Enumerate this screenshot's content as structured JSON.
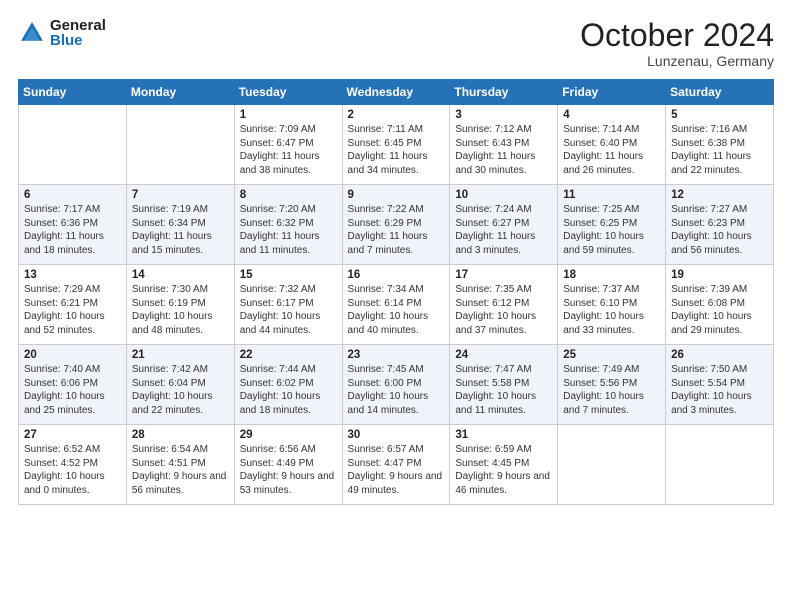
{
  "header": {
    "logo_general": "General",
    "logo_blue": "Blue",
    "title": "October 2024",
    "subtitle": "Lunzenau, Germany"
  },
  "weekdays": [
    "Sunday",
    "Monday",
    "Tuesday",
    "Wednesday",
    "Thursday",
    "Friday",
    "Saturday"
  ],
  "weeks": [
    [
      {
        "day": "",
        "info": ""
      },
      {
        "day": "",
        "info": ""
      },
      {
        "day": "1",
        "info": "Sunrise: 7:09 AM\nSunset: 6:47 PM\nDaylight: 11 hours and 38 minutes."
      },
      {
        "day": "2",
        "info": "Sunrise: 7:11 AM\nSunset: 6:45 PM\nDaylight: 11 hours and 34 minutes."
      },
      {
        "day": "3",
        "info": "Sunrise: 7:12 AM\nSunset: 6:43 PM\nDaylight: 11 hours and 30 minutes."
      },
      {
        "day": "4",
        "info": "Sunrise: 7:14 AM\nSunset: 6:40 PM\nDaylight: 11 hours and 26 minutes."
      },
      {
        "day": "5",
        "info": "Sunrise: 7:16 AM\nSunset: 6:38 PM\nDaylight: 11 hours and 22 minutes."
      }
    ],
    [
      {
        "day": "6",
        "info": "Sunrise: 7:17 AM\nSunset: 6:36 PM\nDaylight: 11 hours and 18 minutes."
      },
      {
        "day": "7",
        "info": "Sunrise: 7:19 AM\nSunset: 6:34 PM\nDaylight: 11 hours and 15 minutes."
      },
      {
        "day": "8",
        "info": "Sunrise: 7:20 AM\nSunset: 6:32 PM\nDaylight: 11 hours and 11 minutes."
      },
      {
        "day": "9",
        "info": "Sunrise: 7:22 AM\nSunset: 6:29 PM\nDaylight: 11 hours and 7 minutes."
      },
      {
        "day": "10",
        "info": "Sunrise: 7:24 AM\nSunset: 6:27 PM\nDaylight: 11 hours and 3 minutes."
      },
      {
        "day": "11",
        "info": "Sunrise: 7:25 AM\nSunset: 6:25 PM\nDaylight: 10 hours and 59 minutes."
      },
      {
        "day": "12",
        "info": "Sunrise: 7:27 AM\nSunset: 6:23 PM\nDaylight: 10 hours and 56 minutes."
      }
    ],
    [
      {
        "day": "13",
        "info": "Sunrise: 7:29 AM\nSunset: 6:21 PM\nDaylight: 10 hours and 52 minutes."
      },
      {
        "day": "14",
        "info": "Sunrise: 7:30 AM\nSunset: 6:19 PM\nDaylight: 10 hours and 48 minutes."
      },
      {
        "day": "15",
        "info": "Sunrise: 7:32 AM\nSunset: 6:17 PM\nDaylight: 10 hours and 44 minutes."
      },
      {
        "day": "16",
        "info": "Sunrise: 7:34 AM\nSunset: 6:14 PM\nDaylight: 10 hours and 40 minutes."
      },
      {
        "day": "17",
        "info": "Sunrise: 7:35 AM\nSunset: 6:12 PM\nDaylight: 10 hours and 37 minutes."
      },
      {
        "day": "18",
        "info": "Sunrise: 7:37 AM\nSunset: 6:10 PM\nDaylight: 10 hours and 33 minutes."
      },
      {
        "day": "19",
        "info": "Sunrise: 7:39 AM\nSunset: 6:08 PM\nDaylight: 10 hours and 29 minutes."
      }
    ],
    [
      {
        "day": "20",
        "info": "Sunrise: 7:40 AM\nSunset: 6:06 PM\nDaylight: 10 hours and 25 minutes."
      },
      {
        "day": "21",
        "info": "Sunrise: 7:42 AM\nSunset: 6:04 PM\nDaylight: 10 hours and 22 minutes."
      },
      {
        "day": "22",
        "info": "Sunrise: 7:44 AM\nSunset: 6:02 PM\nDaylight: 10 hours and 18 minutes."
      },
      {
        "day": "23",
        "info": "Sunrise: 7:45 AM\nSunset: 6:00 PM\nDaylight: 10 hours and 14 minutes."
      },
      {
        "day": "24",
        "info": "Sunrise: 7:47 AM\nSunset: 5:58 PM\nDaylight: 10 hours and 11 minutes."
      },
      {
        "day": "25",
        "info": "Sunrise: 7:49 AM\nSunset: 5:56 PM\nDaylight: 10 hours and 7 minutes."
      },
      {
        "day": "26",
        "info": "Sunrise: 7:50 AM\nSunset: 5:54 PM\nDaylight: 10 hours and 3 minutes."
      }
    ],
    [
      {
        "day": "27",
        "info": "Sunrise: 6:52 AM\nSunset: 4:52 PM\nDaylight: 10 hours and 0 minutes."
      },
      {
        "day": "28",
        "info": "Sunrise: 6:54 AM\nSunset: 4:51 PM\nDaylight: 9 hours and 56 minutes."
      },
      {
        "day": "29",
        "info": "Sunrise: 6:56 AM\nSunset: 4:49 PM\nDaylight: 9 hours and 53 minutes."
      },
      {
        "day": "30",
        "info": "Sunrise: 6:57 AM\nSunset: 4:47 PM\nDaylight: 9 hours and 49 minutes."
      },
      {
        "day": "31",
        "info": "Sunrise: 6:59 AM\nSunset: 4:45 PM\nDaylight: 9 hours and 46 minutes."
      },
      {
        "day": "",
        "info": ""
      },
      {
        "day": "",
        "info": ""
      }
    ]
  ]
}
